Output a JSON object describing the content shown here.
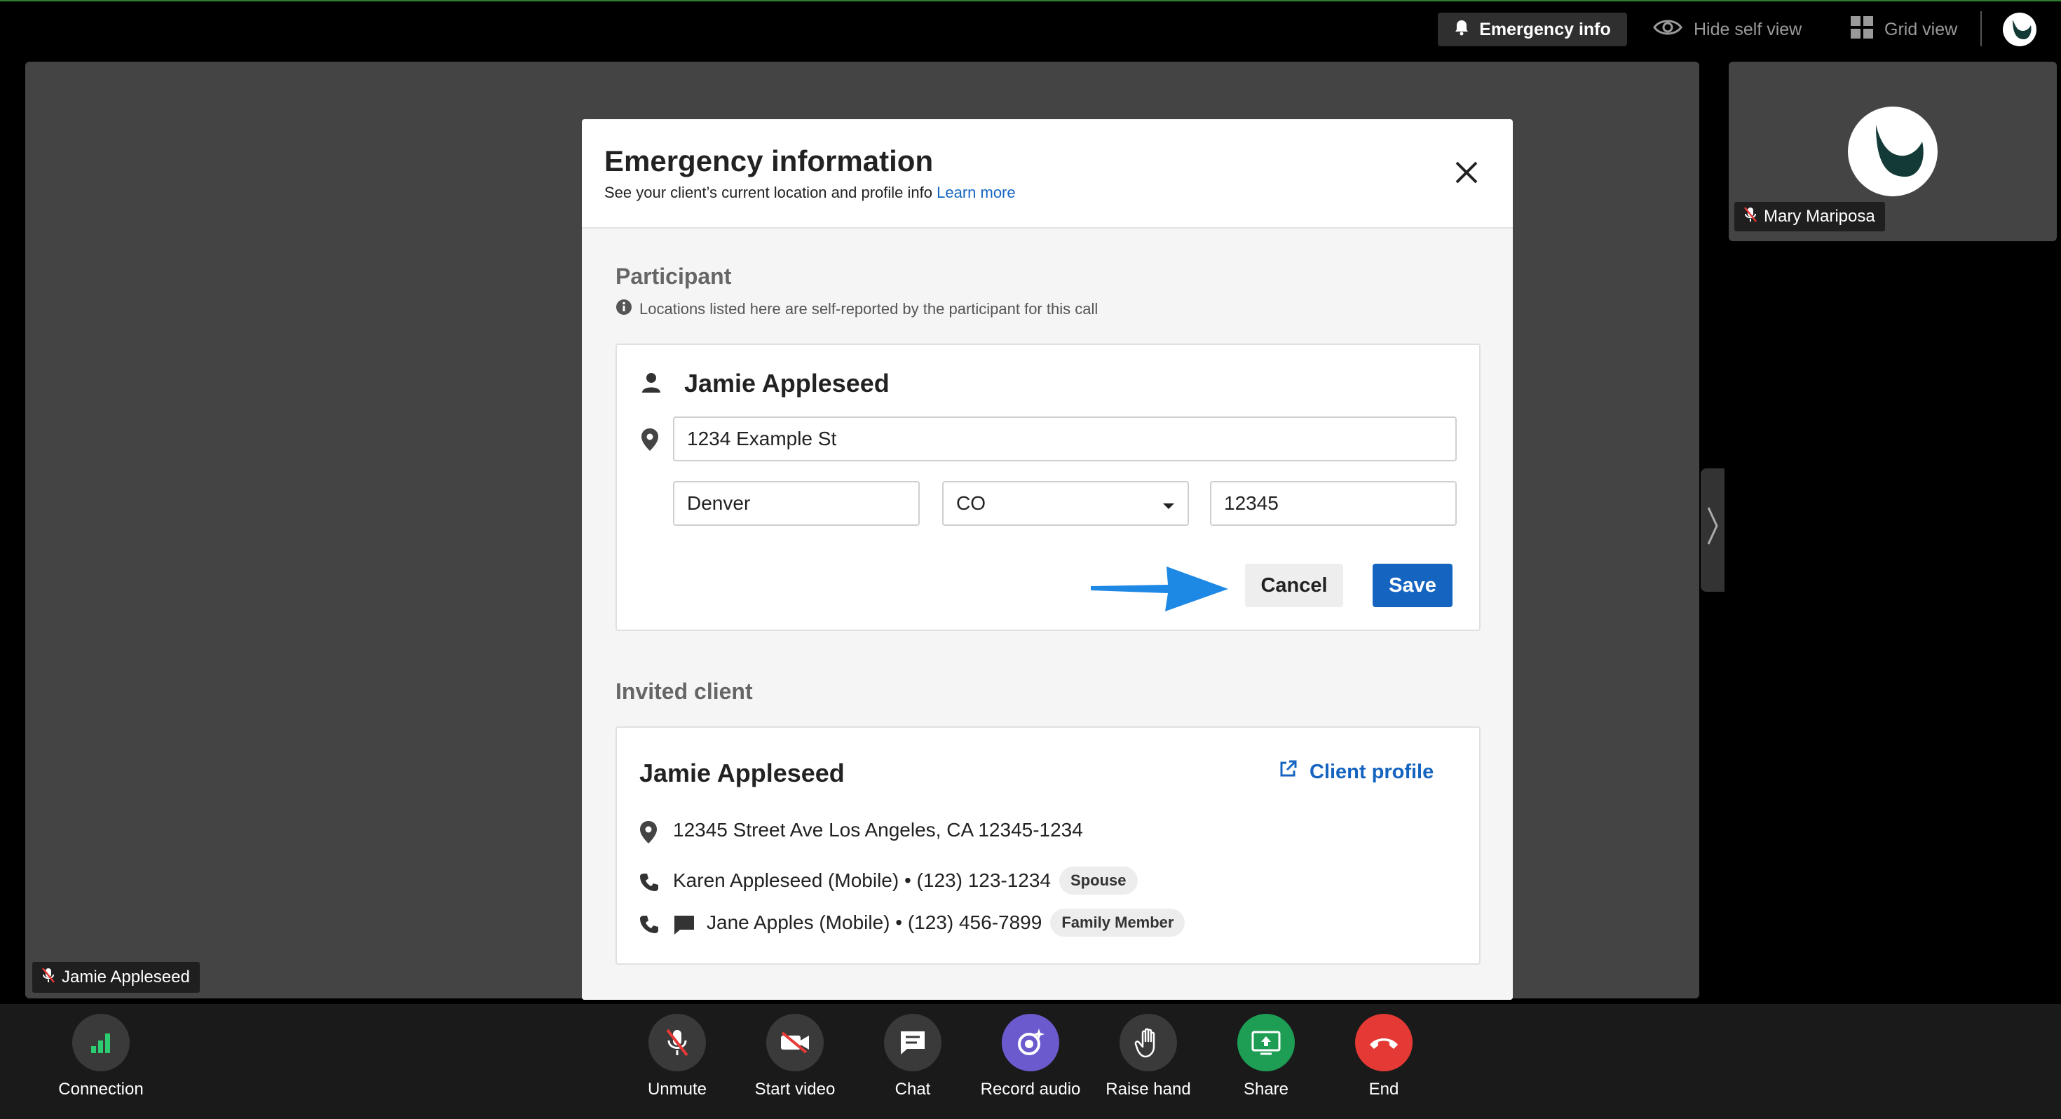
{
  "topbar": {
    "emergency_label": "Emergency info",
    "hide_self_label": "Hide self view",
    "grid_view_label": "Grid view"
  },
  "stage": {
    "participant_tag": "Jamie Appleseed"
  },
  "side_tile": {
    "name": "Mary Mariposa"
  },
  "modal": {
    "title": "Emergency information",
    "subtitle": "See your client’s current location and profile info",
    "learn_more": "Learn more",
    "participant": {
      "section_title": "Participant",
      "note": "Locations listed here are self-reported by the participant for this call",
      "name": "Jamie Appleseed",
      "street": "1234 Example St",
      "city": "Denver",
      "state": "CO",
      "zip": "12345",
      "cancel_label": "Cancel",
      "save_label": "Save"
    },
    "invited": {
      "section_title": "Invited client",
      "name": "Jamie Appleseed",
      "profile_link": "Client profile",
      "address": "12345 Street Ave Los Angeles, CA 12345-1234",
      "contacts": [
        {
          "text": "Karen Appleseed (Mobile) • (123) 123-1234",
          "badge": "Spouse"
        },
        {
          "text": "Jane Apples (Mobile) • (123) 456-7899",
          "badge": "Family Member"
        }
      ]
    }
  },
  "controls": {
    "connection": "Connection",
    "unmute": "Unmute",
    "start_video": "Start video",
    "chat": "Chat",
    "record_audio": "Record audio",
    "raise_hand": "Raise hand",
    "share": "Share",
    "end": "End"
  },
  "colors": {
    "accent_blue": "#1565c0",
    "arrow_blue": "#1e88e5",
    "record_purple": "#6a5acd",
    "share_green": "#1e9e55",
    "end_red": "#e53935",
    "connection_green": "#2ecc71"
  }
}
